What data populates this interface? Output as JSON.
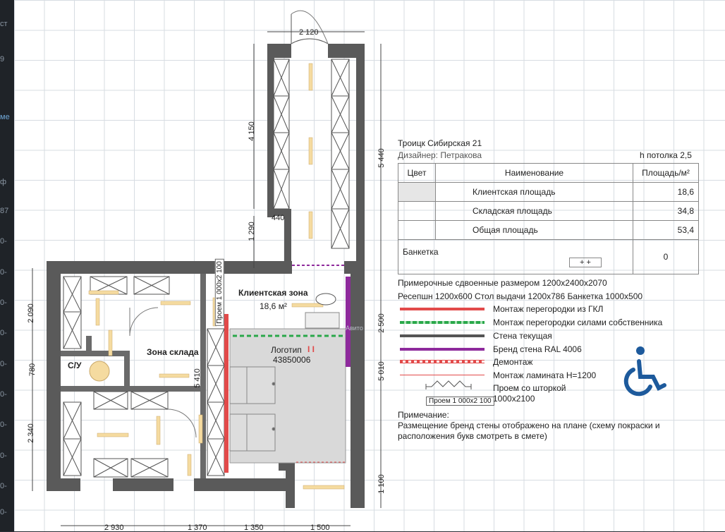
{
  "edge_stubs": [
    "ст",
    "9",
    "ме",
    "ф",
    "87",
    "0-",
    "0-",
    "0-",
    "0-",
    "0-",
    "0-",
    "0-",
    "0-",
    "0-",
    "0-",
    "0-"
  ],
  "plan": {
    "top_width": "2 120",
    "dim_4150": "4 150",
    "dim_440": "440",
    "dim_1290": "1 290",
    "dim_5440": "5 440",
    "dim_2090": "2 090",
    "dim_780": "780",
    "dim_2340": "2 340",
    "dim_2500": "2 500",
    "dim_5010": "5 010",
    "dim_1100": "1 100",
    "dim_5410": "5 410",
    "bottom_dims": [
      "2 930",
      "1 370",
      "1 350",
      "1 500"
    ],
    "opening_label": "Проем 1 000х2 100",
    "client_zone": "Клиентская зона",
    "client_area": "18,6 м²",
    "storage_zone": "Зона склада",
    "wc": "С/У",
    "logo_label": "Логотип",
    "logo_code": "43850006",
    "logo_mark": "I I",
    "watermark": "Авито"
  },
  "title": {
    "line1": "Троицк Сибирская 21",
    "designer": "Дизайнер: Петракова",
    "ceiling": "h потолка 2,5"
  },
  "table": {
    "headers": [
      "Цвет",
      "Наименование",
      "Площадь/м²"
    ],
    "rows": [
      {
        "name": "Клиентская площадь",
        "area": "18,6"
      },
      {
        "name": "Складская площадь",
        "area": "34,8"
      },
      {
        "name": "Общая площадь",
        "area": "53,4"
      },
      {
        "name": "Банкетка",
        "area": "0"
      }
    ]
  },
  "notes": {
    "line1": "Примерочные сдвоенные размером 1200х2400х2070",
    "line2": "Ресепшн 1200х600    Стол выдачи 1200х786    Банкетка 1000х500"
  },
  "legend": [
    {
      "label": "Монтаж перегородки из ГКЛ",
      "color": "#e24a4a"
    },
    {
      "label": "Монтаж перегородки силами собственника",
      "color": "#2aa84a"
    },
    {
      "label": "Стена текущая",
      "color": "#555555"
    },
    {
      "label": "Бренд стена RAL 4006",
      "color": "#8e2a9c"
    },
    {
      "label": "Демонтаж",
      "color": "#e24a4a"
    },
    {
      "label": "Монтаж ламината Н=1200",
      "color": "#e24a4a"
    },
    {
      "label": "Проем со шторкой",
      "color": "#555555"
    },
    {
      "label": "1000х2100",
      "color": "#555555"
    }
  ],
  "legend_opening": "Проем 1 000х2 100",
  "remark": {
    "title": "Примечание:",
    "text1": "Размещение бренд стены отображено на плане (схему покраски и",
    "text2": "расположения букв смотреть в смете)"
  },
  "colors": {
    "wall": "#5a5a5a",
    "accent_blue": "#1d5a9c",
    "gkl": "#e24a4a",
    "owner": "#2aa84a",
    "brand": "#8e2a9c",
    "light": "#f5dba0"
  }
}
